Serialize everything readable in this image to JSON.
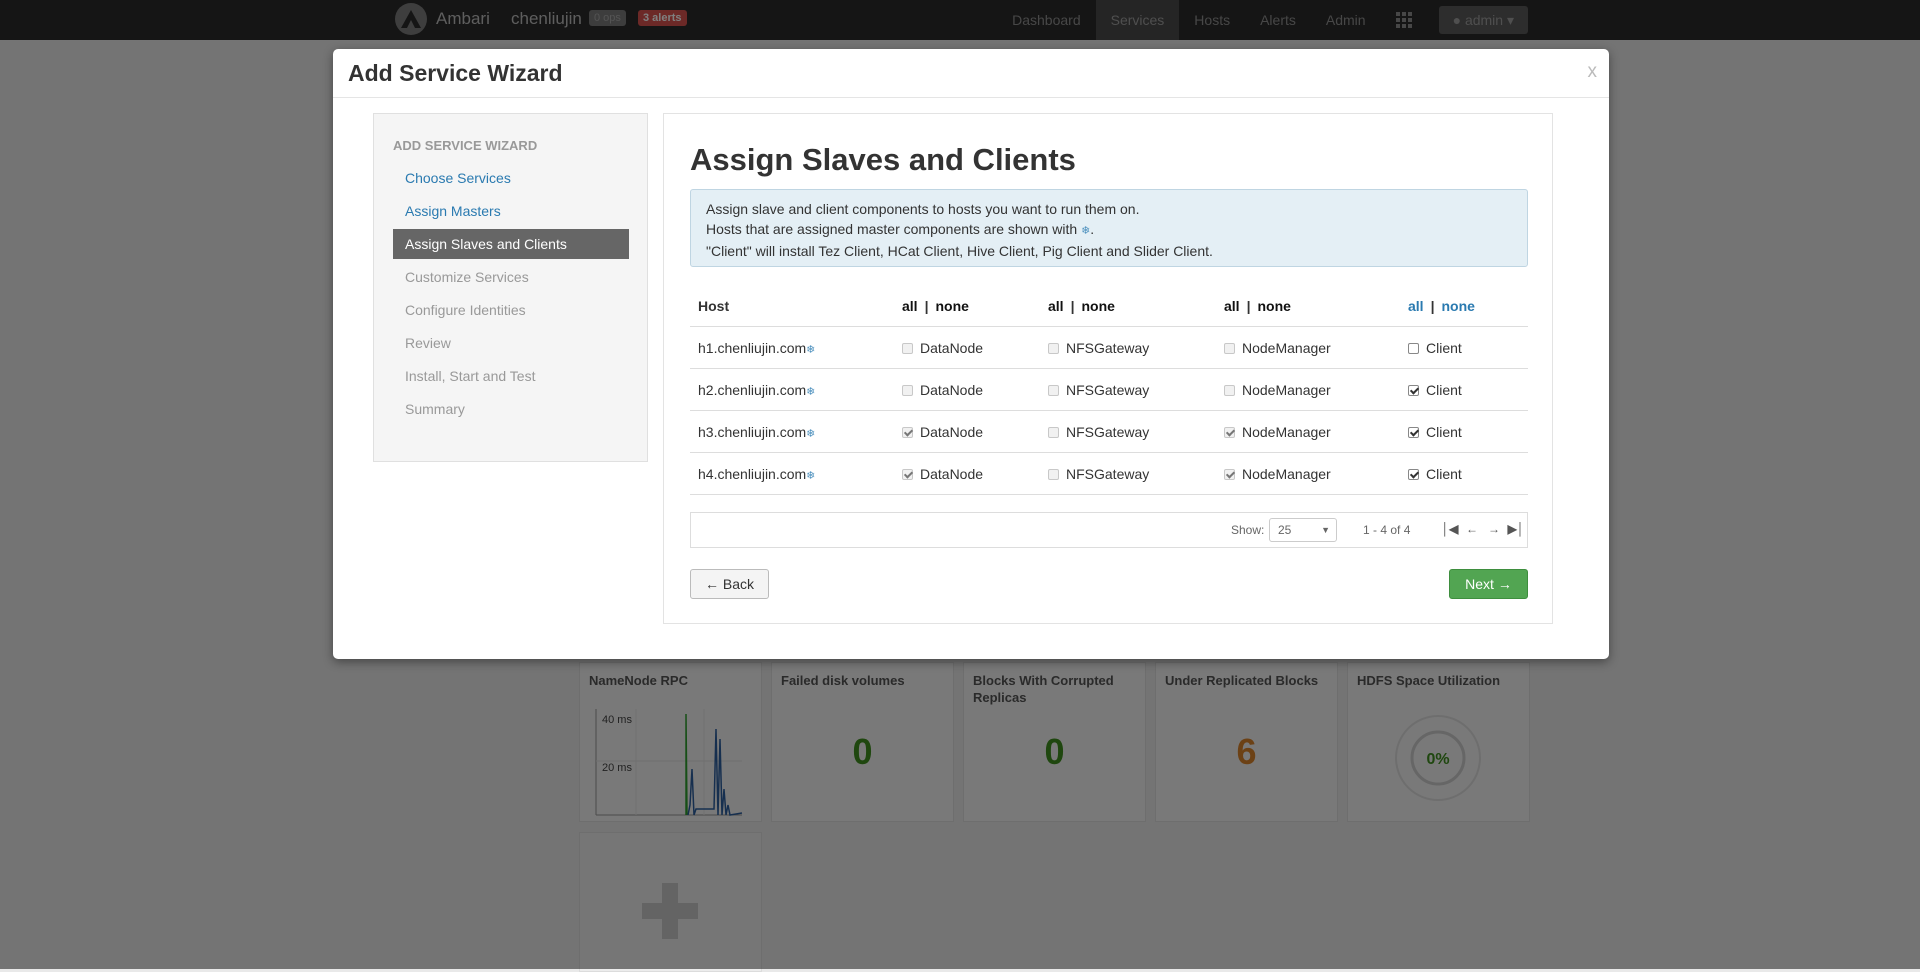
{
  "navbar": {
    "brand": "Ambari",
    "cluster": "chenliujin",
    "ops_badge": "0 ops",
    "alerts_badge": "3 alerts",
    "links": [
      "Dashboard",
      "Services",
      "Hosts",
      "Alerts",
      "Admin"
    ],
    "active_link": "Services",
    "user": "admin"
  },
  "dashboard": {
    "widgets": [
      {
        "title": "NameNode RPC",
        "type": "graph",
        "labels": [
          "40 ms",
          "20 ms"
        ]
      },
      {
        "title": "Failed disk volumes",
        "value": "0",
        "color": "#3f8f1f"
      },
      {
        "title": "Blocks With Corrupted Replicas",
        "value": "0",
        "color": "#3f8f1f"
      },
      {
        "title": "Under Replicated Blocks",
        "value": "6",
        "color": "#d9822b"
      },
      {
        "title": "HDFS Space Utilization",
        "value": "0%",
        "color": "#3f8f1f"
      }
    ]
  },
  "modal": {
    "title": "Add Service Wizard",
    "close": "x"
  },
  "wizard": {
    "header": "ADD SERVICE WIZARD",
    "steps": [
      {
        "label": "Choose Services",
        "state": "link"
      },
      {
        "label": "Assign Masters",
        "state": "link"
      },
      {
        "label": "Assign Slaves and Clients",
        "state": "active"
      },
      {
        "label": "Customize Services",
        "state": "disabled"
      },
      {
        "label": "Configure Identities",
        "state": "disabled"
      },
      {
        "label": "Review",
        "state": "disabled"
      },
      {
        "label": "Install, Start and Test",
        "state": "disabled"
      },
      {
        "label": "Summary",
        "state": "disabled"
      }
    ]
  },
  "content": {
    "title": "Assign Slaves and Clients",
    "info": {
      "line1": "Assign slave and client components to hosts you want to run them on.",
      "line2_prefix": "Hosts that are assigned master components are shown with ",
      "line2_suffix": ".",
      "line3": "\"Client\" will install Tez Client, HCat Client, Hive Client, Pig Client and Slider Client."
    },
    "table": {
      "host_header": "Host",
      "all_label": "all",
      "none_label": "none",
      "columns": [
        "DataNode",
        "NFSGateway",
        "NodeManager",
        "Client"
      ],
      "rows": [
        {
          "host": "h1.chenliujin.com",
          "master": true,
          "checks": [
            false,
            false,
            false,
            false
          ]
        },
        {
          "host": "h2.chenliujin.com",
          "master": true,
          "checks": [
            false,
            false,
            false,
            true
          ]
        },
        {
          "host": "h3.chenliujin.com",
          "master": true,
          "checks": [
            true,
            false,
            true,
            true
          ]
        },
        {
          "host": "h4.chenliujin.com",
          "master": true,
          "checks": [
            true,
            false,
            true,
            true
          ]
        }
      ]
    },
    "pager": {
      "show_label": "Show:",
      "page_size": "25",
      "range": "1 - 4 of 4"
    },
    "back_label": "← Back",
    "next_label": "Next →"
  },
  "icons": {
    "logo": "ambari-logo-icon",
    "master": "snowflake-icon",
    "user": "user-icon",
    "apps": "grid-icon"
  },
  "colors": {
    "link": "#2a7ab0",
    "active_step": "#666666",
    "info_bg": "#e4eff5",
    "next_button": "#52a552",
    "alert_badge": "#d9534f"
  }
}
